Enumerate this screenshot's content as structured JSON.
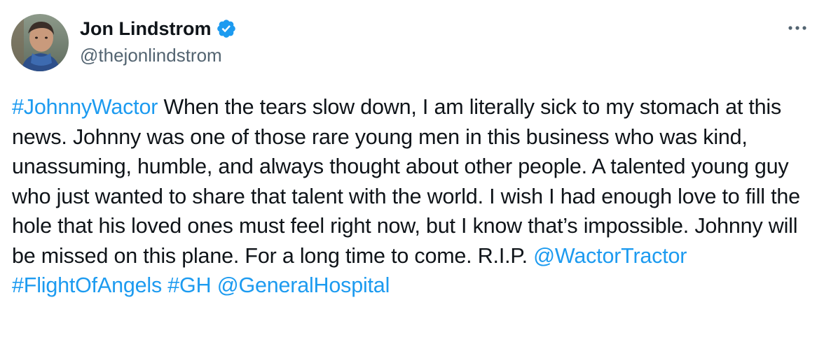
{
  "author": {
    "display_name": "Jon Lindstrom",
    "handle": "@thejonlindstrom",
    "verified": true
  },
  "more_icon": "more-horizontal-icon",
  "tweet": {
    "segments": [
      {
        "text": "#JohnnyWactor",
        "type": "hashtag"
      },
      {
        "text": " When the tears slow down, I am literally sick to my stomach at this news. Johnny was one of those rare young men in this business who was kind, unassuming, humble, and always thought about other people. A talented young guy who just wanted to share that talent with the world. I wish I had enough love to fill the hole that his loved ones must feel right now, but I know that’s impossible. Johnny will be missed on this plane. For a long time to come. R.I.P. ",
        "type": "text"
      },
      {
        "text": "@WactorTractor",
        "type": "mention"
      },
      {
        "text": " ",
        "type": "text"
      },
      {
        "text": "#FlightOfAngels",
        "type": "hashtag"
      },
      {
        "text": " ",
        "type": "text"
      },
      {
        "text": "#GH",
        "type": "hashtag"
      },
      {
        "text": " ",
        "type": "text"
      },
      {
        "text": "@GeneralHospital",
        "type": "mention"
      }
    ]
  },
  "colors": {
    "link": "#1d9bf0",
    "text": "#0f1419",
    "secondary": "#536471",
    "verified_badge": "#1d9bf0"
  }
}
